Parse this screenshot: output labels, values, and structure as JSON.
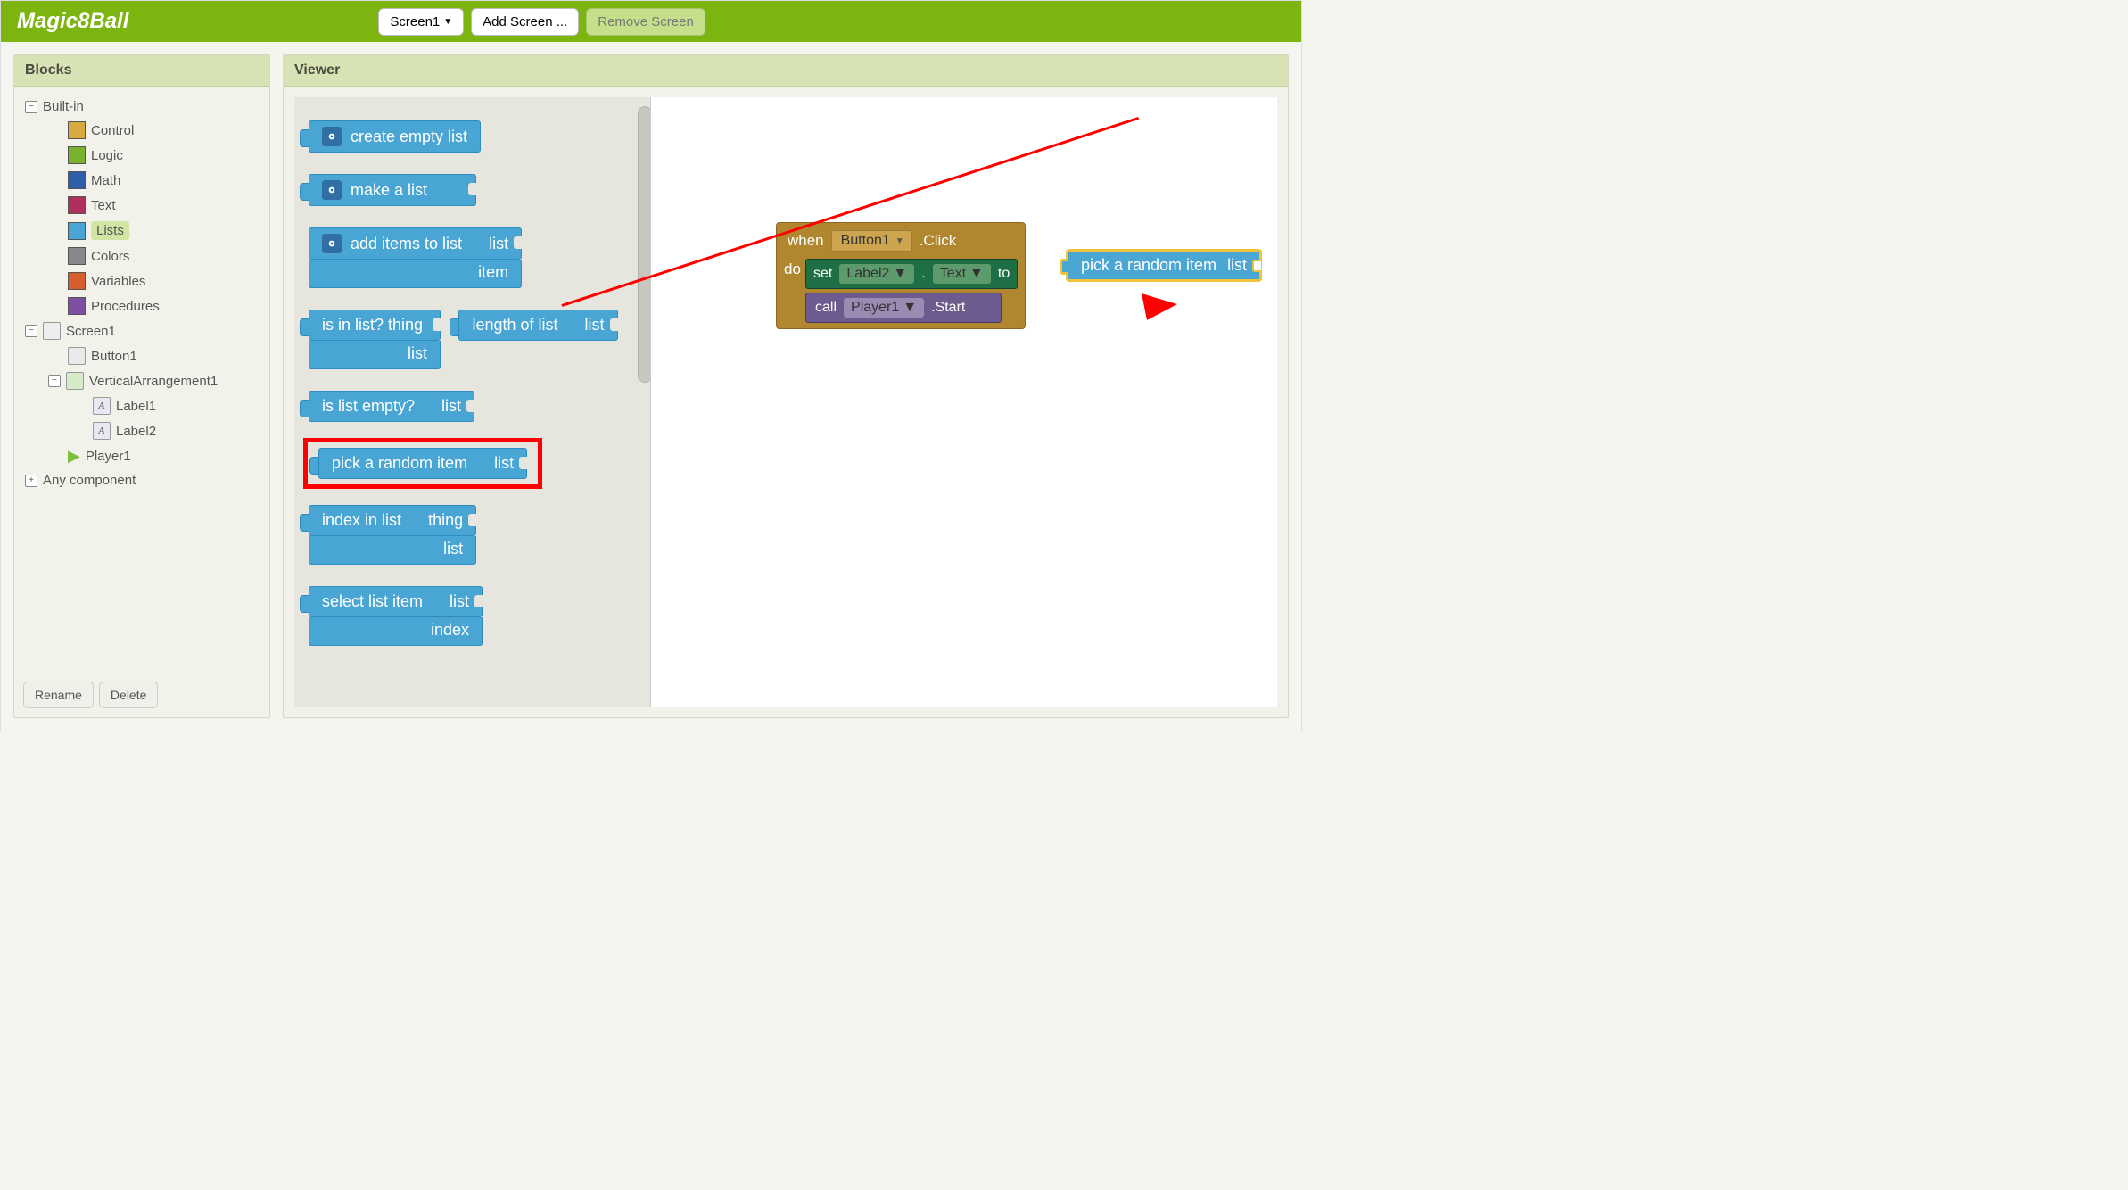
{
  "app": {
    "title": "Magic8Ball"
  },
  "toolbar": {
    "screen_selector": "Screen1",
    "add_screen": "Add Screen ...",
    "remove_screen": "Remove Screen"
  },
  "panels": {
    "blocks": "Blocks",
    "viewer": "Viewer"
  },
  "tree": {
    "builtin": "Built-in",
    "cats": {
      "control": "Control",
      "logic": "Logic",
      "math": "Math",
      "text": "Text",
      "lists": "Lists",
      "colors": "Colors",
      "variables": "Variables",
      "procedures": "Procedures"
    },
    "screen1": "Screen1",
    "button1": "Button1",
    "vert1": "VerticalArrangement1",
    "label1": "Label1",
    "label2": "Label2",
    "player1": "Player1",
    "anycomp": "Any component"
  },
  "footer": {
    "rename": "Rename",
    "delete": "Delete"
  },
  "drawer": {
    "b1": "create empty list",
    "b2": "make a list",
    "b3a": "add items to list",
    "b3b": "list",
    "b3c": "item",
    "b4a": "is in list? thing",
    "b4b": "list",
    "b5a": "length of list",
    "b5b": "list",
    "b6a": "is list empty?",
    "b6b": "list",
    "b7a": "pick a random item",
    "b7b": "list",
    "b8a": "index in list",
    "b8b": "thing",
    "b8c": "list",
    "b9a": "select list item",
    "b9b": "list",
    "b9c": "index"
  },
  "canvas": {
    "when": "when",
    "button1": "Button1",
    "click": ".Click",
    "do": "do",
    "set": "set",
    "label2": "Label2",
    "dot": ".",
    "text": "Text",
    "to": "to",
    "call": "call",
    "player1": "Player1",
    "start": ".Start",
    "pick": "pick a random item",
    "list": "list"
  }
}
